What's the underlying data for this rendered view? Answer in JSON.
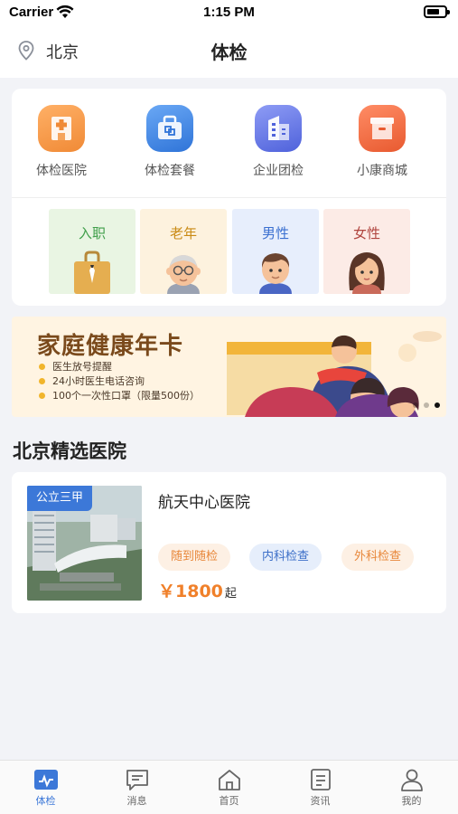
{
  "status_bar": {
    "carrier": "Carrier",
    "time": "1:15 PM",
    "battery_level": 0.7
  },
  "nav": {
    "city": "北京",
    "title": "体检"
  },
  "categories": [
    {
      "label": "体检医院",
      "icon": "hospital-icon",
      "color": "#f5923b"
    },
    {
      "label": "体检套餐",
      "icon": "package-icon",
      "color": "#3f86e6"
    },
    {
      "label": "企业团检",
      "icon": "enterprise-icon",
      "color": "#5b6fe0"
    },
    {
      "label": "小康商城",
      "icon": "mall-icon",
      "color": "#ef6a3f"
    }
  ],
  "tags": [
    {
      "label": "入职",
      "color": "#3f9e4a",
      "bg": "#e9f5e3"
    },
    {
      "label": "老年",
      "color": "#c98a13",
      "bg": "#fdf2de"
    },
    {
      "label": "男性",
      "color": "#3a6fd0",
      "bg": "#e7eefc"
    },
    {
      "label": "女性",
      "color": "#b0443e",
      "bg": "#fcebe6"
    }
  ],
  "banner": {
    "title": "家庭健康年卡",
    "items": [
      "医生放号提醒",
      "24小时医生电话咨询",
      "100个一次性口罩（限量500份）"
    ],
    "page_count": 3,
    "active_page": 3
  },
  "section": {
    "title": "北京精选医院"
  },
  "hospital": {
    "badge": "公立三甲",
    "name": "航天中心医院",
    "tags": [
      {
        "label": "随到随检",
        "color": "#e8873a",
        "bg": "#fdf0e4"
      },
      {
        "label": "内科检查",
        "color": "#3c6fc8",
        "bg": "#e6eefb"
      },
      {
        "label": "外科检查",
        "color": "#e8873a",
        "bg": "#fdf0e4"
      }
    ],
    "price": "￥1800",
    "price_suffix": "起"
  },
  "tabs": [
    {
      "label": "体检",
      "icon": "checkup-icon",
      "active": true
    },
    {
      "label": "消息",
      "icon": "message-icon",
      "active": false
    },
    {
      "label": "首页",
      "icon": "home-icon",
      "active": false
    },
    {
      "label": "资讯",
      "icon": "news-icon",
      "active": false
    },
    {
      "label": "我的",
      "icon": "profile-icon",
      "active": false
    }
  ],
  "colors": {
    "accent": "#3c78d8",
    "price": "#f0802a",
    "background": "#f2f3f7"
  }
}
